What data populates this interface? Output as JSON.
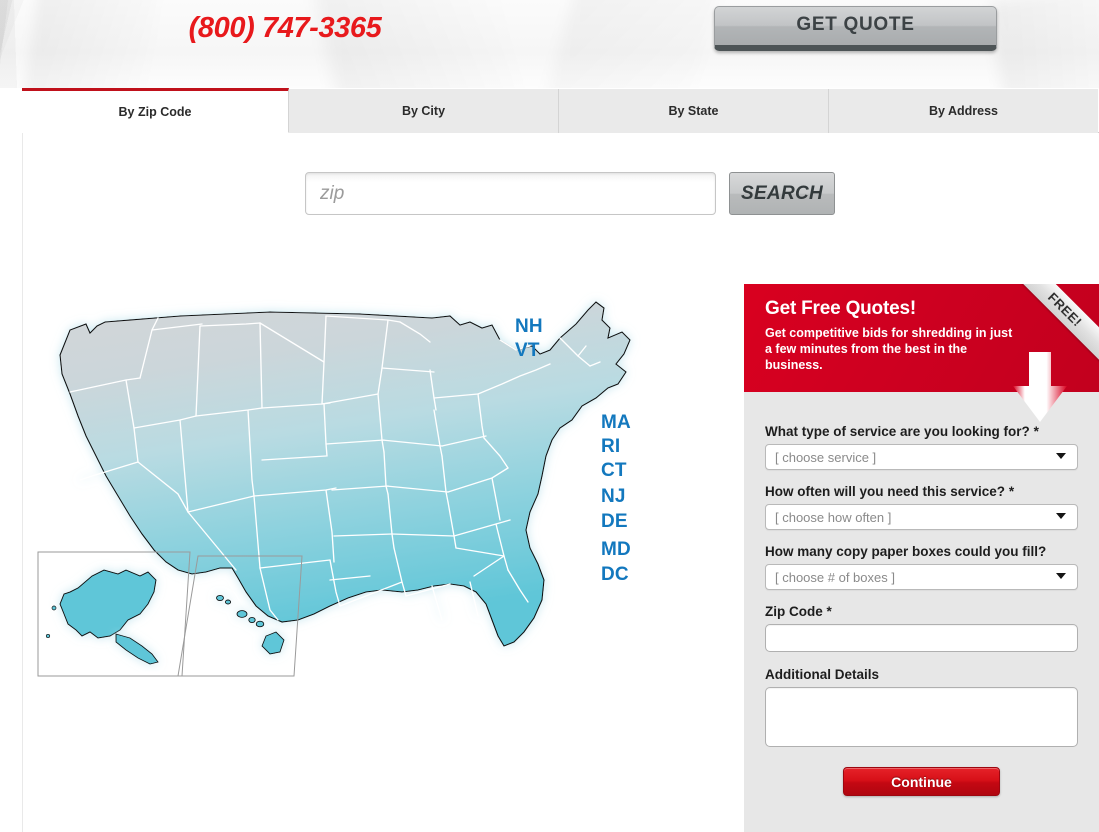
{
  "header": {
    "phone": "(800) 747-3365",
    "get_quote_label": "GET QUOTE"
  },
  "tabs": [
    {
      "label": "By Zip Code",
      "active": true
    },
    {
      "label": "By City",
      "active": false
    },
    {
      "label": "By State",
      "active": false
    },
    {
      "label": "By Address",
      "active": false
    }
  ],
  "search": {
    "placeholder": "zip",
    "value": "",
    "button_label": "SEARCH"
  },
  "map": {
    "label_color": "#1378be",
    "state_labels_top": [
      "NH",
      "VT"
    ],
    "state_labels_right": [
      "MA",
      "RI",
      "CT",
      "NJ",
      "DE",
      "MD",
      "DC"
    ],
    "insets": [
      "Alaska",
      "Hawaii"
    ]
  },
  "quote": {
    "ribbon": "FREE!",
    "title": "Get Free Quotes!",
    "subtitle": "Get competitive bids for shredding in just a few minutes from the best in the business.",
    "accent_color": "#cf0020",
    "fields": [
      {
        "label": "What type of service are you looking for?",
        "required": "*",
        "value": "[ choose service ]",
        "type": "select"
      },
      {
        "label": "How often will you need this service?",
        "required": "*",
        "value": "[ choose how often ]",
        "type": "select"
      },
      {
        "label": "How many copy paper boxes could you fill?",
        "required": "",
        "value": "[ choose # of boxes ]",
        "type": "select"
      },
      {
        "label": "Zip Code",
        "required": "*",
        "value": "",
        "type": "text"
      },
      {
        "label": "Additional Details",
        "required": "",
        "value": "",
        "type": "textarea"
      }
    ],
    "continue_label": "Continue"
  }
}
